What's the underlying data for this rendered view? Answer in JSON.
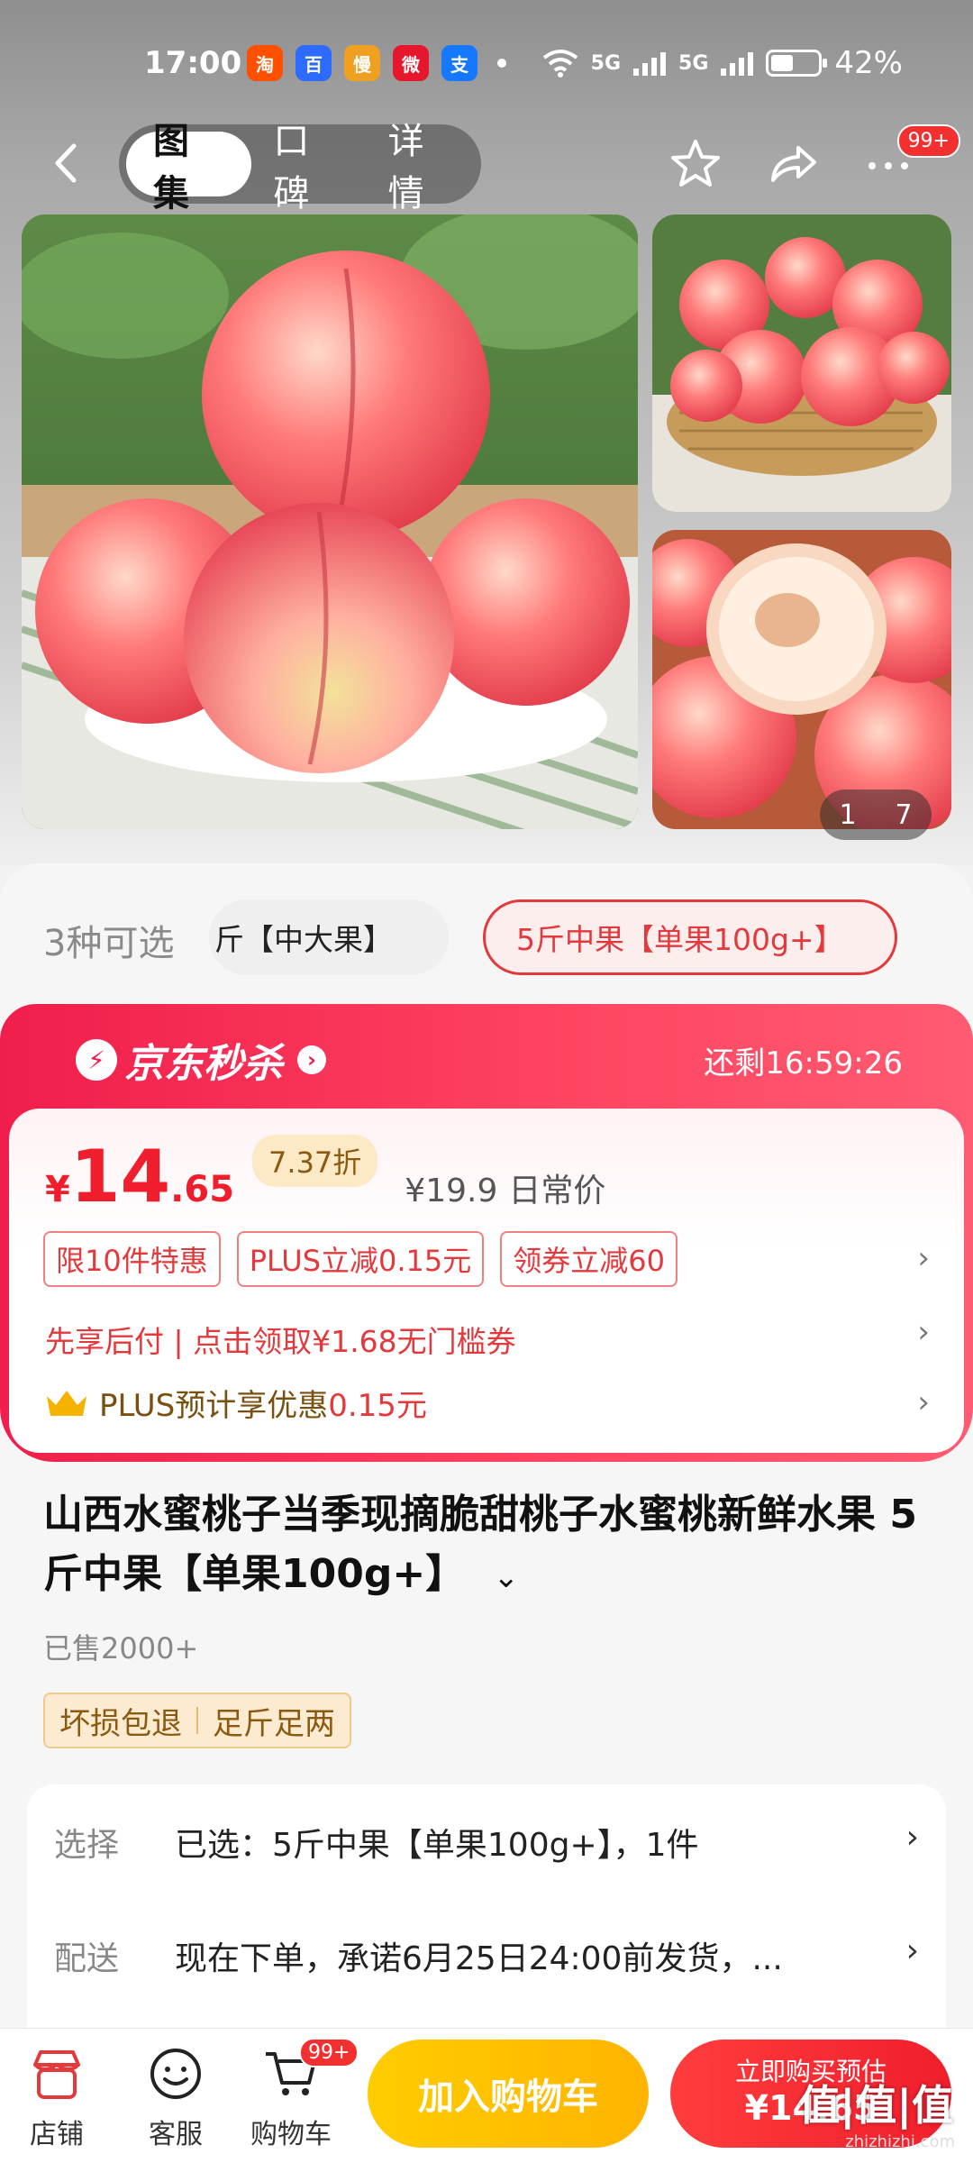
{
  "status": {
    "time": "17:00",
    "apps": [
      {
        "name": "taobao-icon",
        "glyph": "淘",
        "color": "#ff5000"
      },
      {
        "name": "baidu-icon",
        "glyph": "百",
        "color": "#2d6bff"
      },
      {
        "name": "manman-icon",
        "glyph": "慢",
        "color": "#f0a020"
      },
      {
        "name": "weibo-icon",
        "glyph": "微",
        "color": "#e6162d"
      },
      {
        "name": "alipay-icon",
        "glyph": "支",
        "color": "#1677ff"
      }
    ],
    "net1": "5G",
    "net2": "5G",
    "battery": "42%"
  },
  "nav": {
    "tabs": [
      "图集",
      "口碑",
      "详情"
    ],
    "active_tab": "图集",
    "more_badge": "99+"
  },
  "gallery": {
    "index": "1",
    "total": "7"
  },
  "variants": {
    "label": "3种可选",
    "options": [
      "斤【中大果】",
      "5斤中果【单果100g+】"
    ],
    "selected": "5斤中果【单果100g+】"
  },
  "flash_sale": {
    "title": "京东秒杀",
    "timer": "还剩16:59:26",
    "currency": "¥",
    "price_int": "14",
    "price_dec": ".65",
    "discount": "7.37折",
    "original_price": "¥19.9",
    "original_label": "日常价",
    "tags": [
      "限10件特惠",
      "PLUS立减0.15元",
      "领券立减60"
    ],
    "promo": "先享后付 | 点击领取¥1.68无门槛券",
    "plus_text": "PLUS预计享优惠",
    "plus_amount": "0.15元"
  },
  "product": {
    "title": "山西水蜜桃子当季现摘脆甜桃子水蜜桃新鲜水果 5斤中果【单果100g+】",
    "sold": "已售2000+",
    "badges": [
      "坏损包退",
      "足斤足两"
    ]
  },
  "info": {
    "select_key": "选择",
    "select_val": "已选：5斤中果【单果100g+】，1件",
    "delivery_key": "配送",
    "delivery_val": "现在下单，承诺6月25日24:00前发货，..."
  },
  "bottom": {
    "store": "店铺",
    "service": "客服",
    "cart": "购物车",
    "cart_badge": "99+",
    "add_cart": "加入购物车",
    "buy_line1": "立即购买预估",
    "buy_line2": "¥14.65"
  },
  "watermark": {
    "main": "值|值|值",
    "sub": "zhizhizhi.com"
  }
}
